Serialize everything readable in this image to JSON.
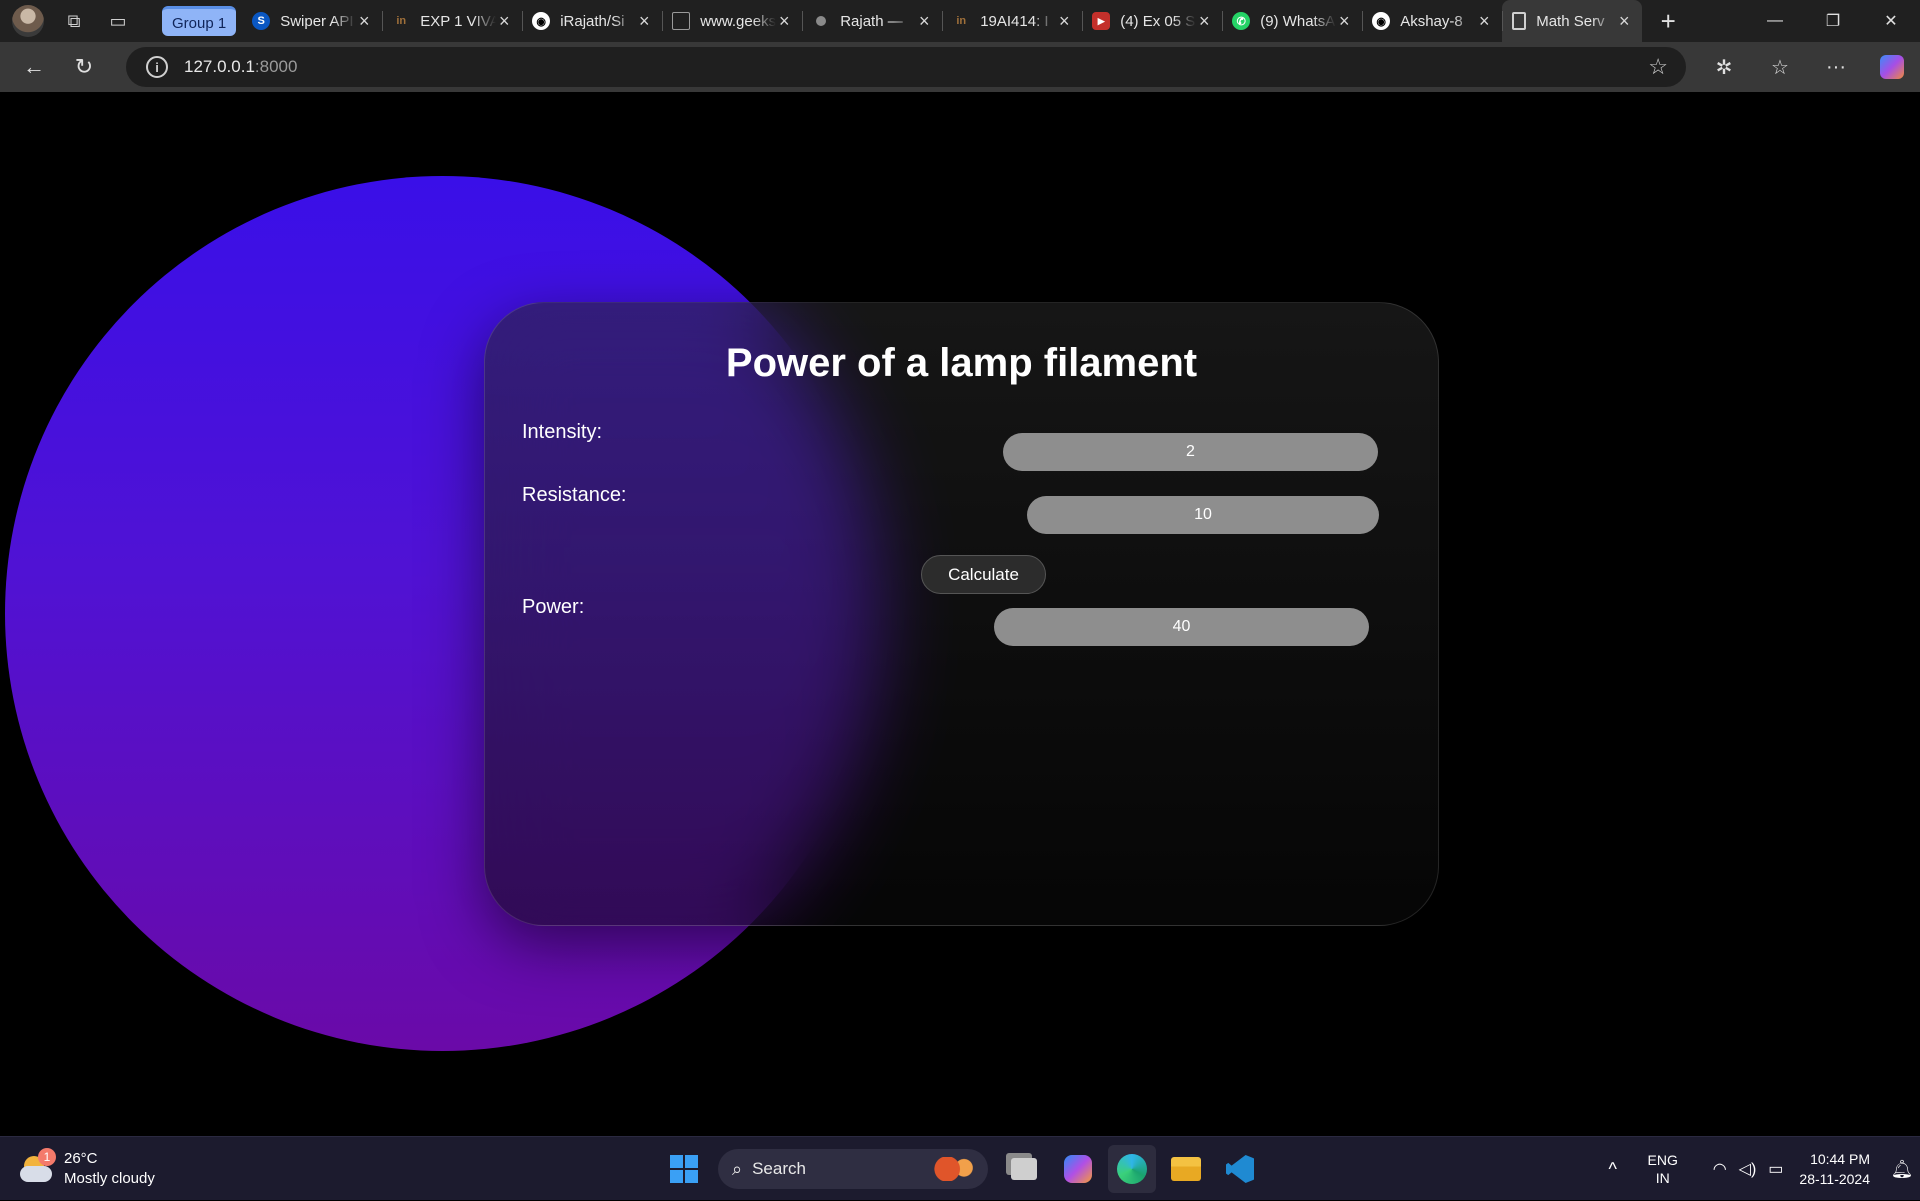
{
  "browser": {
    "group_label": "Group 1",
    "tabs": [
      {
        "title": "Swiper API",
        "favicon": "swiper-logo",
        "color": "#0a57c2"
      },
      {
        "title": "EXP 1 VIVA",
        "favicon": "in-logo",
        "color": "#6b4a2a"
      },
      {
        "title": "iRajath/Si",
        "favicon": "github-logo",
        "color": "#ffffff"
      },
      {
        "title": "www.geeks",
        "favicon": "document-logo",
        "color": "#9a9a9a"
      },
      {
        "title": "Rajath —",
        "favicon": "dot-logo",
        "color": "#8a8a8a"
      },
      {
        "title": "19AI414: I",
        "favicon": "in-logo",
        "color": "#6b4a2a"
      },
      {
        "title": "(4) Ex 05 S",
        "favicon": "youtube-logo",
        "color": "#c4302b"
      },
      {
        "title": "(9) WhatsA",
        "favicon": "whatsapp-logo",
        "color": "#25d366"
      },
      {
        "title": "Akshay-8",
        "favicon": "github-logo",
        "color": "#ffffff"
      },
      {
        "title": "Math Serv",
        "favicon": "page-icon",
        "color": "#d0d0d0",
        "active": true
      }
    ],
    "url_host": "127.0.0.1",
    "url_port": ":8000"
  },
  "page": {
    "title": "Power of a lamp filament",
    "fields": [
      {
        "label": "Intensity:",
        "value": "2"
      },
      {
        "label": "Resistance:",
        "value": "10"
      }
    ],
    "calculate_label": "Calculate",
    "result": {
      "label": "Power:",
      "value": "40"
    },
    "colors": {
      "blob_top": "#3a0fe8",
      "blob_bottom": "#6a0aa8",
      "field_bg": "#8e8e8e"
    }
  },
  "taskbar": {
    "weather": {
      "temp": "26°C",
      "condition": "Mostly cloudy",
      "badge": "1"
    },
    "search_label": "Search",
    "lang_line1": "ENG",
    "lang_line2": "IN",
    "time": "10:44 PM",
    "date": "28-11-2024"
  }
}
